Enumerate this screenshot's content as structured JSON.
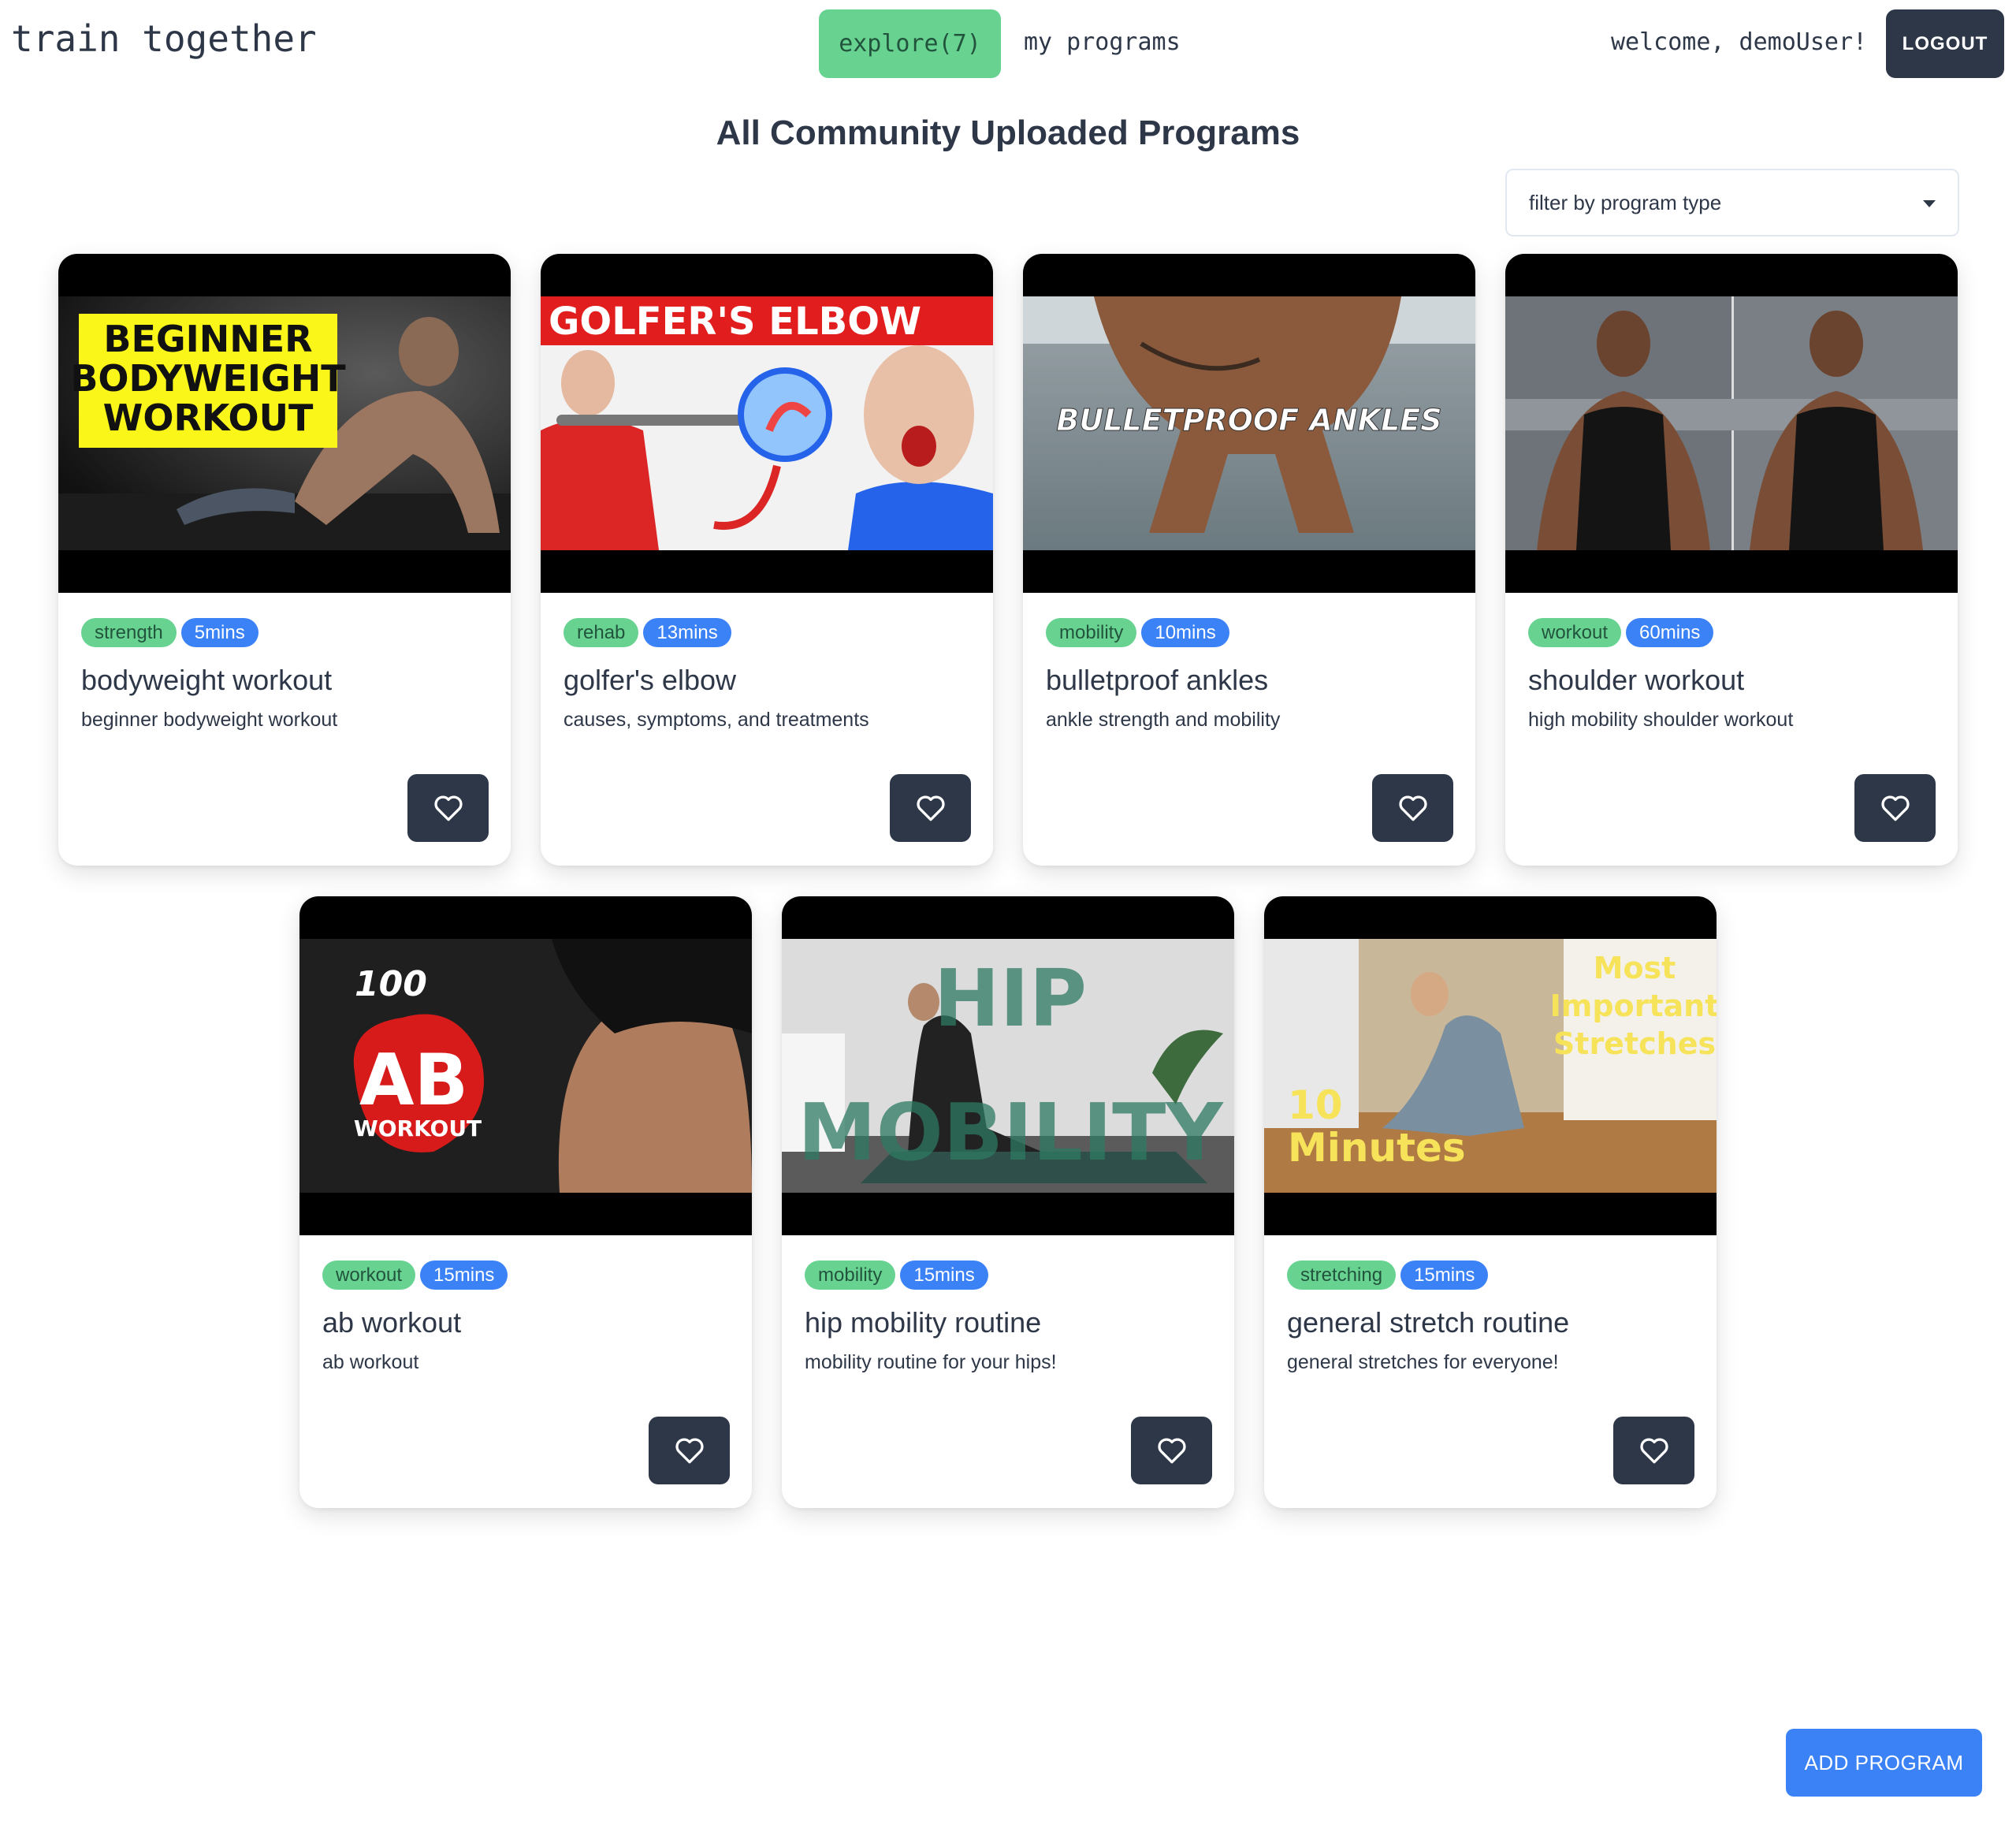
{
  "header": {
    "brand": "train together",
    "nav_explore": "explore(7)",
    "nav_my_programs": "my programs",
    "welcome": "welcome, demoUser!",
    "logout": "LOGOUT"
  },
  "main": {
    "title": "All Community Uploaded Programs",
    "filter_placeholder": "filter by program type",
    "add_program": "ADD PROGRAM"
  },
  "programs": [
    {
      "type": "strength",
      "duration": "5mins",
      "title": "bodyweight workout",
      "description": "beginner bodyweight workout",
      "thumb_lines": [
        "BEGINNER",
        "BODYWEIGHT",
        "WORKOUT"
      ]
    },
    {
      "type": "rehab",
      "duration": "13mins",
      "title": "golfer's elbow",
      "description": "causes, symptoms, and treatments",
      "thumb_lines": [
        "GOLFER'S ELBOW"
      ]
    },
    {
      "type": "mobility",
      "duration": "10mins",
      "title": "bulletproof ankles",
      "description": "ankle strength and mobility",
      "thumb_lines": [
        "BULLETPROOF ANKLES"
      ]
    },
    {
      "type": "workout",
      "duration": "60mins",
      "title": "shoulder workout",
      "description": "high mobility shoulder workout",
      "thumb_lines": []
    },
    {
      "type": "workout",
      "duration": "15mins",
      "title": "ab workout",
      "description": "ab workout",
      "thumb_lines": [
        "100",
        "AB",
        "WORKOUT"
      ]
    },
    {
      "type": "mobility",
      "duration": "15mins",
      "title": "hip mobility routine",
      "description": "mobility routine for your hips!",
      "thumb_lines": [
        "HIP",
        "MOBILITY"
      ]
    },
    {
      "type": "stretching",
      "duration": "15mins",
      "title": "general stretch routine",
      "description": "general stretches for everyone!",
      "thumb_lines": [
        "Most",
        "Important",
        "Stretches",
        "10",
        "Minutes"
      ]
    }
  ],
  "colors": {
    "dark": "#2d3748",
    "green": "#68d391",
    "blue": "#3b82f6"
  },
  "icons": {
    "favorite": "heart-outline-icon",
    "filter_caret": "caret-down-icon"
  }
}
